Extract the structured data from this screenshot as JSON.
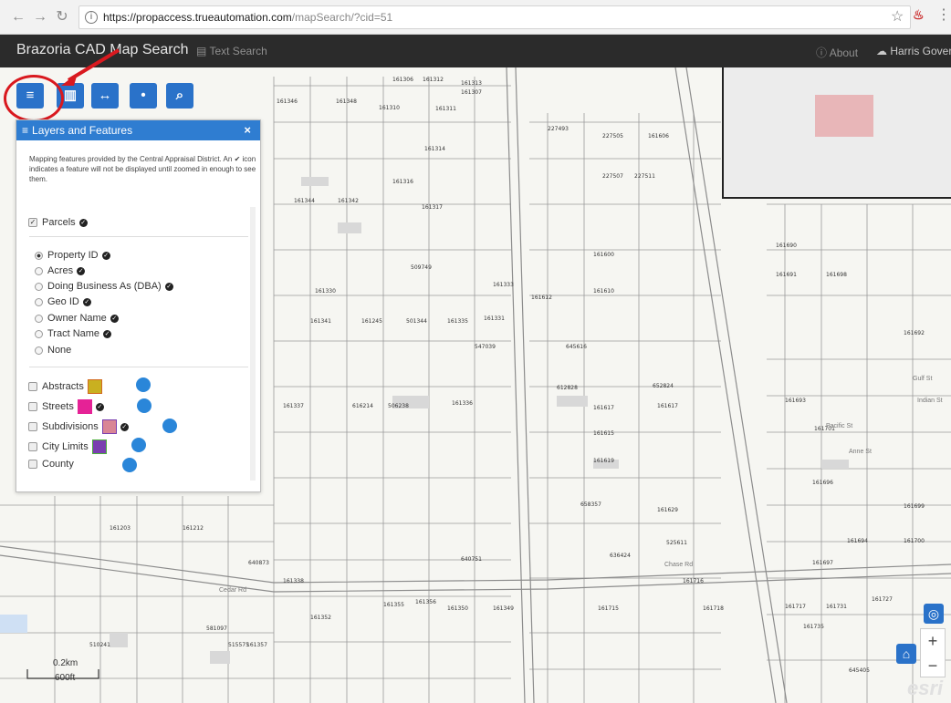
{
  "browser": {
    "url_host": "https://propaccess.trueautomation.com",
    "url_path": "/mapSearch/?cid=51"
  },
  "appbar": {
    "brand": "Brazoria CAD Map Search",
    "text_search": "Text Search",
    "about": "About",
    "harris": "Harris Gover"
  },
  "toolbar": {
    "layers_glyph": "≡",
    "basemap_glyph": "▥",
    "nav_glyph": "↔",
    "locate_glyph": "•",
    "search_glyph": "⌕"
  },
  "panel": {
    "title": "Layers and Features",
    "close": "×",
    "description": "Mapping features provided by the Central Appraisal District. An ✔ icon indicates a feature will not be displayed until zoomed in enough to see them.",
    "parcels_label": "Parcels",
    "label_options": [
      "Property ID",
      "Acres",
      "Doing Business As (DBA)",
      "Geo ID",
      "Owner Name",
      "Tract Name",
      "None"
    ],
    "selected_option": "Property ID",
    "layers": [
      {
        "label": "Abstracts",
        "color": "#c9b020"
      },
      {
        "label": "Streets",
        "color": "#e52296"
      },
      {
        "label": "Subdivisions",
        "color": "#d98595"
      },
      {
        "label": "City Limits",
        "color": "#7a3fb0"
      },
      {
        "label": "County",
        "color": ""
      }
    ]
  },
  "map": {
    "parcels": [
      "161306",
      "161312",
      "161313",
      "161307",
      "161310",
      "161311",
      "161314",
      "161316",
      "161346",
      "161348",
      "161344",
      "161342",
      "161317",
      "509749",
      "161330",
      "161333",
      "161341",
      "161245",
      "501344",
      "161335",
      "161331",
      "547039",
      "161337",
      "616214",
      "506238",
      "161336",
      "161203",
      "161212",
      "640873",
      "636424",
      "640751",
      "161338",
      "161352",
      "161349",
      "161715",
      "161718",
      "510241",
      "515575",
      "161357",
      "161355",
      "161356",
      "161350",
      "581097",
      "227493",
      "227505",
      "227507",
      "227511",
      "161606",
      "161600",
      "161612",
      "161610",
      "645616",
      "612828",
      "652824",
      "161617",
      "161615",
      "161619",
      "161617",
      "658357",
      "161629",
      "525611",
      "161716",
      "161690",
      "161691",
      "161698",
      "161692",
      "161693",
      "161701",
      "161699",
      "161694",
      "161696",
      "161700",
      "161697",
      "161735",
      "161731",
      "161717",
      "161727",
      "645405"
    ],
    "roads": [
      "Gulf St",
      "Indian St",
      "Pacific St",
      "Anne St",
      "Chase Rd",
      "Cedar Rd"
    ],
    "scale_km": "0.2km",
    "scale_ft": "600ft",
    "attribution": "esri"
  },
  "zoom": {
    "in": "+",
    "out": "−"
  }
}
